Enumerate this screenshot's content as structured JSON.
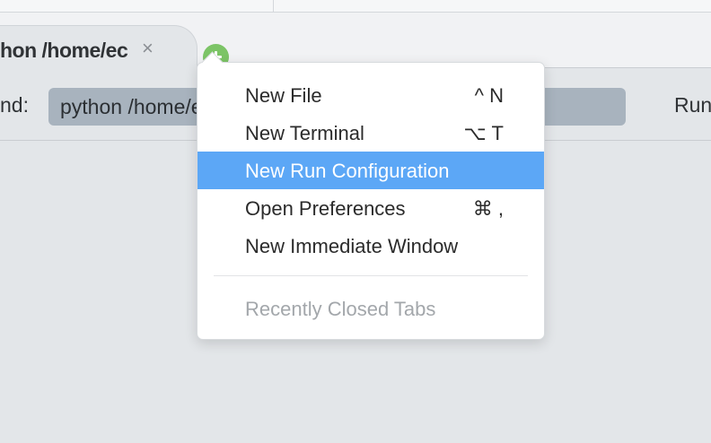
{
  "tab": {
    "title": "hon /home/ec",
    "close_glyph": "×"
  },
  "toolbar": {
    "command_label": "nd:",
    "command_value": "python /home/ec2-user/environment/rm/goc",
    "run_label": "Run"
  },
  "menu": {
    "items": [
      {
        "label": "New File",
        "shortcut": "^ N"
      },
      {
        "label": "New Terminal",
        "shortcut": "⌥ T"
      },
      {
        "label": "New Run Configuration",
        "shortcut": ""
      },
      {
        "label": "Open Preferences",
        "shortcut": "⌘ ,"
      },
      {
        "label": "New Immediate Window",
        "shortcut": ""
      }
    ],
    "recently_closed": "Recently Closed Tabs"
  },
  "colors": {
    "highlight": "#5ca7f6",
    "add_button": "#7cc466",
    "command_input": "#a8b3be"
  }
}
